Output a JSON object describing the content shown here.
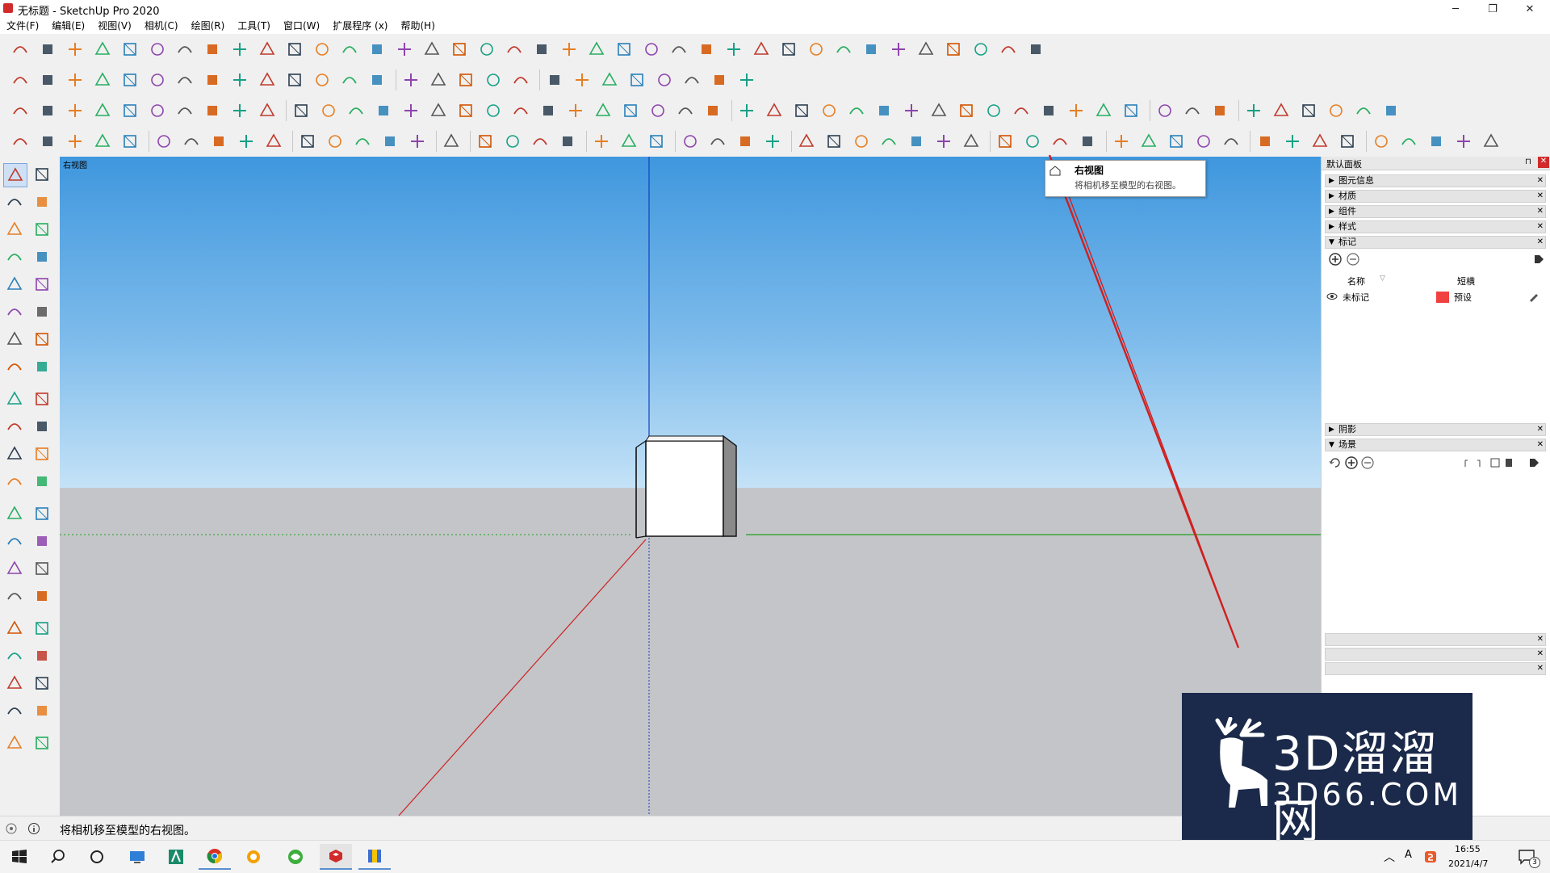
{
  "window": {
    "title": "无标题 - SketchUp Pro 2020",
    "minimize": "─",
    "maximize": "❐",
    "close": "✕"
  },
  "menu": [
    "文件(F)",
    "编辑(E)",
    "视图(V)",
    "相机(C)",
    "绘图(R)",
    "工具(T)",
    "窗口(W)",
    "扩展程序 (x)",
    "帮助(H)"
  ],
  "viewport": {
    "scene_label": "右视图"
  },
  "tooltip": {
    "title": "右视图",
    "description": "将相机移至模型的右视图。"
  },
  "tray": {
    "title": "默认面板",
    "panels": [
      "图元信息",
      "材质",
      "组件",
      "样式",
      "标记"
    ],
    "tags_columns": {
      "name": "名称",
      "dash": "短横"
    },
    "tag_row": {
      "name": "未标记",
      "dash": "预设",
      "color": "#f04040"
    },
    "lower_panels": [
      "阴影",
      "场景"
    ]
  },
  "status": {
    "message": "将相机移至模型的右视图。"
  },
  "taskbar": {
    "time": "16:55",
    "date": "2021/4/7",
    "notification_count": "3"
  },
  "watermark": {
    "brand_main": "3D溜溜网",
    "brand_sub": "3D66.COM"
  },
  "colors": {
    "accent_red": "#d12a2a",
    "axis_blue": "#1040c0",
    "axis_red": "#cc2020",
    "axis_green": "#20a020"
  }
}
